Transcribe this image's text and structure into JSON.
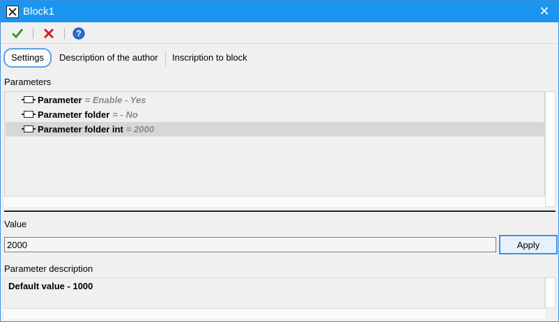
{
  "window": {
    "title": "Block1",
    "app_icon": "block-app-icon",
    "close_label": "✕"
  },
  "toolbar": {
    "ok_icon": "checkmark-icon",
    "cancel_icon": "red-x-icon",
    "help_icon": "help-icon",
    "ok_glyph": "✔",
    "cancel_glyph": "✖",
    "help_glyph": "?"
  },
  "tabs": [
    {
      "label": "Settings",
      "active": true
    },
    {
      "label": "Description of the author",
      "active": false
    },
    {
      "label": "Inscription to block",
      "active": false
    }
  ],
  "parameters": {
    "label": "Parameters",
    "items": [
      {
        "name": "Parameter",
        "value": "= Enable - Yes",
        "selected": false
      },
      {
        "name": "Parameter folder",
        "value": "=  - No",
        "selected": false
      },
      {
        "name": "Parameter folder int",
        "value": "= 2000",
        "selected": true
      }
    ]
  },
  "value": {
    "label": "Value",
    "current": "2000",
    "apply_label": "Apply"
  },
  "description": {
    "label": "Parameter description",
    "text": "Default value - 1000"
  },
  "colors": {
    "titlebar": "#1a96f0",
    "accent": "#3c8fe0",
    "ok": "#3a9a2a",
    "cancel": "#d0201a",
    "help": "#2d6fcf"
  }
}
